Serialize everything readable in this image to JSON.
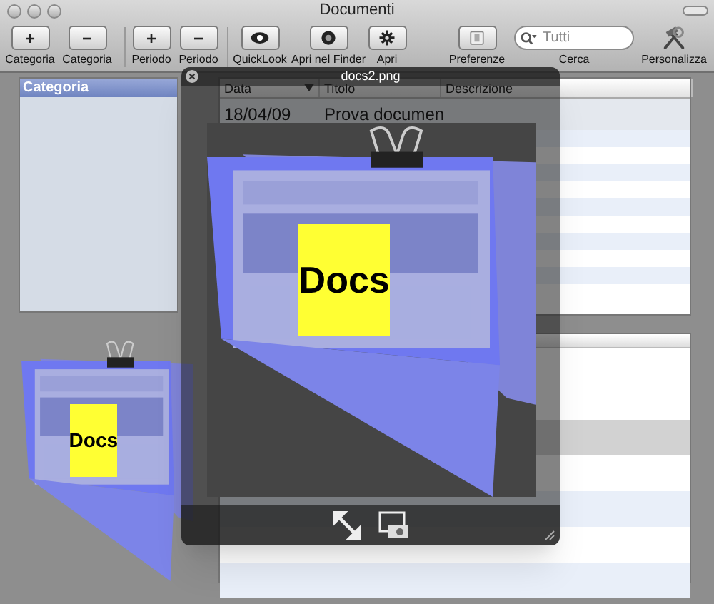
{
  "window": {
    "title": "Documenti"
  },
  "toolbar": {
    "items": [
      {
        "kind": "glyph",
        "glyph": "+",
        "label": "Categoria"
      },
      {
        "kind": "glyph",
        "glyph": "−",
        "label": "Categoria"
      },
      {
        "kind": "glyph",
        "glyph": "+",
        "label": "Periodo"
      },
      {
        "kind": "glyph",
        "glyph": "−",
        "label": "Periodo"
      },
      {
        "kind": "icon",
        "label": "QuickLook"
      },
      {
        "kind": "icon",
        "label": "Apri nel Finder"
      },
      {
        "kind": "icon",
        "label": "Apri"
      },
      {
        "kind": "icon",
        "label": "Preferenze"
      },
      {
        "kind": "search",
        "placeholder": "Tutti",
        "label": "Cerca"
      },
      {
        "kind": "icon",
        "label": "Personalizza"
      }
    ]
  },
  "sidebar": {
    "header": "Categoria"
  },
  "table": {
    "columns": [
      {
        "label": "Data",
        "sorted": true
      },
      {
        "label": "Titolo",
        "sorted": false
      },
      {
        "label": "Descrizione",
        "sorted": false
      }
    ],
    "rows": [
      {
        "cells": [
          "18/04/09",
          "Prova documen"
        ]
      }
    ]
  },
  "quicklook": {
    "title": "docs2.png",
    "note_text": "Docs"
  },
  "dragged_icon": {
    "note_text": "Docs"
  }
}
